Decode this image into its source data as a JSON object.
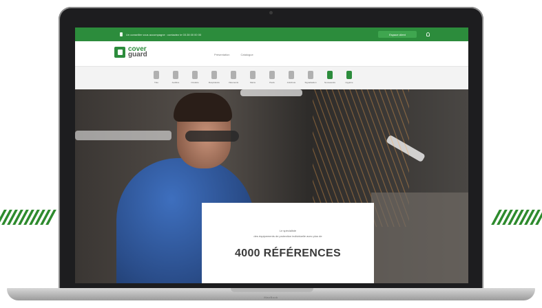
{
  "colors": {
    "brand_green": "#2c8c3c",
    "accent_stripes": "#2e8b2e",
    "laptop_frame": "#1d1d1f"
  },
  "device": {
    "base_label": "MacBook"
  },
  "topbar": {
    "message": "Un conseiller vous accompagne : contactez le 03 28 00 00 00",
    "cta_label": "Espace client",
    "icons": [
      "phone-icon",
      "account-icon"
    ]
  },
  "header": {
    "logo_line1": "cover",
    "logo_line2": "guard",
    "nav": [
      "Présentation",
      "Catalogue"
    ]
  },
  "categories": [
    {
      "label": "Tête",
      "icon": "helmet-icon"
    },
    {
      "label": "Auditive",
      "icon": "ear-icon"
    },
    {
      "label": "Oculaire",
      "icon": "glasses-icon"
    },
    {
      "label": "Respiratoire",
      "icon": "mask-icon"
    },
    {
      "label": "Vêtements",
      "icon": "jacket-icon"
    },
    {
      "label": "Mains",
      "icon": "glove-icon"
    },
    {
      "label": "Pieds",
      "icon": "boot-icon"
    },
    {
      "label": "Antichute",
      "icon": "harness-icon"
    },
    {
      "label": "Signalisation",
      "icon": "sign-icon"
    },
    {
      "label": "Nouveautés",
      "icon": "star-icon"
    },
    {
      "label": "Hygiène",
      "icon": "bottle-icon"
    }
  ],
  "hero": {
    "line1": "Le spécialiste",
    "line2": "des équipements de protection individuelle avec plus de",
    "headline": "4000 RÉFÉRENCES"
  }
}
